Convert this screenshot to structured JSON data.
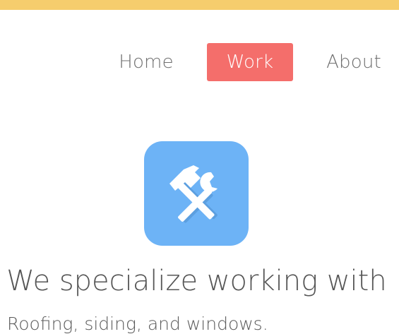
{
  "nav": {
    "items": [
      {
        "label": "Home"
      },
      {
        "label": "Work",
        "active": true
      },
      {
        "label": "About"
      }
    ]
  },
  "hero": {
    "icon": "hammer-wrench-icon",
    "headline": "We specialize working with",
    "subline": "Roofing, siding, and windows."
  },
  "colors": {
    "top_bar": "#f6cd6d",
    "active_nav": "#f46e6b",
    "icon_tile": "#6db3f6"
  }
}
